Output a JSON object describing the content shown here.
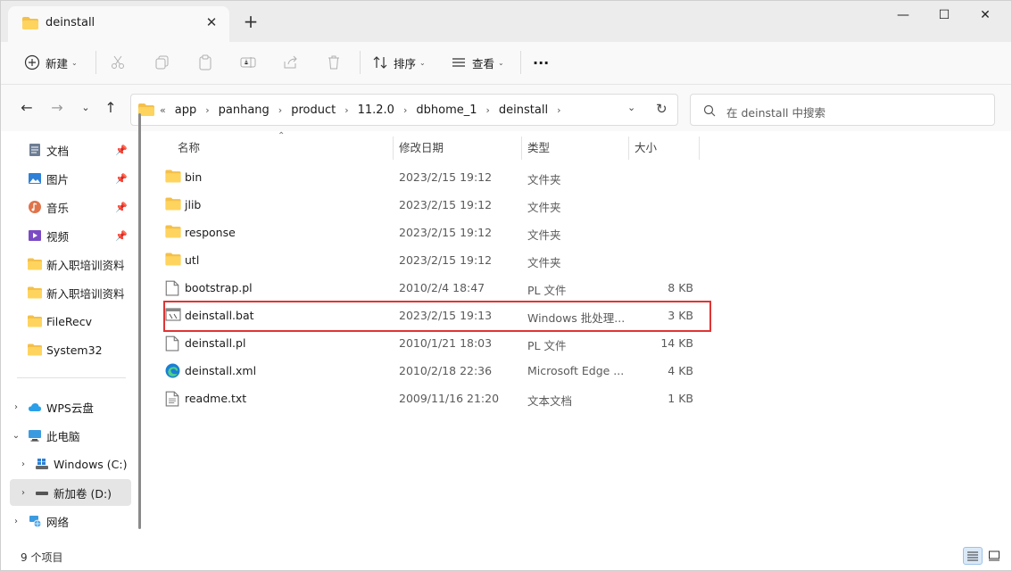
{
  "tab": {
    "title": "deinstall",
    "close_glyph": "✕",
    "new_glyph": "+"
  },
  "window_controls": {
    "minimize": "—",
    "maximize": "☐",
    "close": "✕"
  },
  "toolbar": {
    "new_label": "新建",
    "sort_label": "排序",
    "view_label": "查看",
    "more_label": "···"
  },
  "breadcrumb": {
    "overflow": "«",
    "segments": [
      "app",
      "panhang",
      "product",
      "11.2.0",
      "dbhome_1",
      "deinstall"
    ]
  },
  "search": {
    "placeholder": "在 deinstall 中搜索"
  },
  "sidebar": {
    "quick_access": [
      {
        "label": "文档",
        "icon": "document-icon"
      },
      {
        "label": "图片",
        "icon": "picture-icon"
      },
      {
        "label": "音乐",
        "icon": "music-icon"
      },
      {
        "label": "视频",
        "icon": "video-icon"
      }
    ],
    "folders": [
      {
        "label": "新入职培训资料"
      },
      {
        "label": "新入职培训资料"
      },
      {
        "label": "FileRecv"
      },
      {
        "label": "System32"
      }
    ],
    "tree": [
      {
        "label": "WPS云盘"
      },
      {
        "label": "此电脑"
      },
      {
        "label": "Windows (C:)"
      },
      {
        "label": "新加卷 (D:)"
      },
      {
        "label": "网络"
      }
    ]
  },
  "columns": {
    "name": "名称",
    "modified": "修改日期",
    "type": "类型",
    "size": "大小"
  },
  "files": [
    {
      "name": "bin",
      "date": "2023/2/15 19:12",
      "type": "文件夹",
      "size": "",
      "icon": "folder-icon"
    },
    {
      "name": "jlib",
      "date": "2023/2/15 19:12",
      "type": "文件夹",
      "size": "",
      "icon": "folder-icon"
    },
    {
      "name": "response",
      "date": "2023/2/15 19:12",
      "type": "文件夹",
      "size": "",
      "icon": "folder-icon"
    },
    {
      "name": "utl",
      "date": "2023/2/15 19:12",
      "type": "文件夹",
      "size": "",
      "icon": "folder-icon"
    },
    {
      "name": "bootstrap.pl",
      "date": "2010/2/4 18:47",
      "type": "PL 文件",
      "size": "8 KB",
      "icon": "file-icon"
    },
    {
      "name": "deinstall.bat",
      "date": "2023/2/15 19:13",
      "type": "Windows 批处理...",
      "size": "3 KB",
      "icon": "batch-file-icon"
    },
    {
      "name": "deinstall.pl",
      "date": "2010/1/21 18:03",
      "type": "PL 文件",
      "size": "14 KB",
      "icon": "file-icon"
    },
    {
      "name": "deinstall.xml",
      "date": "2010/2/18 22:36",
      "type": "Microsoft Edge ...",
      "size": "4 KB",
      "icon": "edge-icon"
    },
    {
      "name": "readme.txt",
      "date": "2009/11/16 21:20",
      "type": "文本文档",
      "size": "1 KB",
      "icon": "text-file-icon"
    }
  ],
  "status": {
    "item_count": "9 个项目"
  },
  "colors": {
    "highlight": "#e03434",
    "folder": "#f4c04a",
    "selection": "#e5e5e5"
  }
}
